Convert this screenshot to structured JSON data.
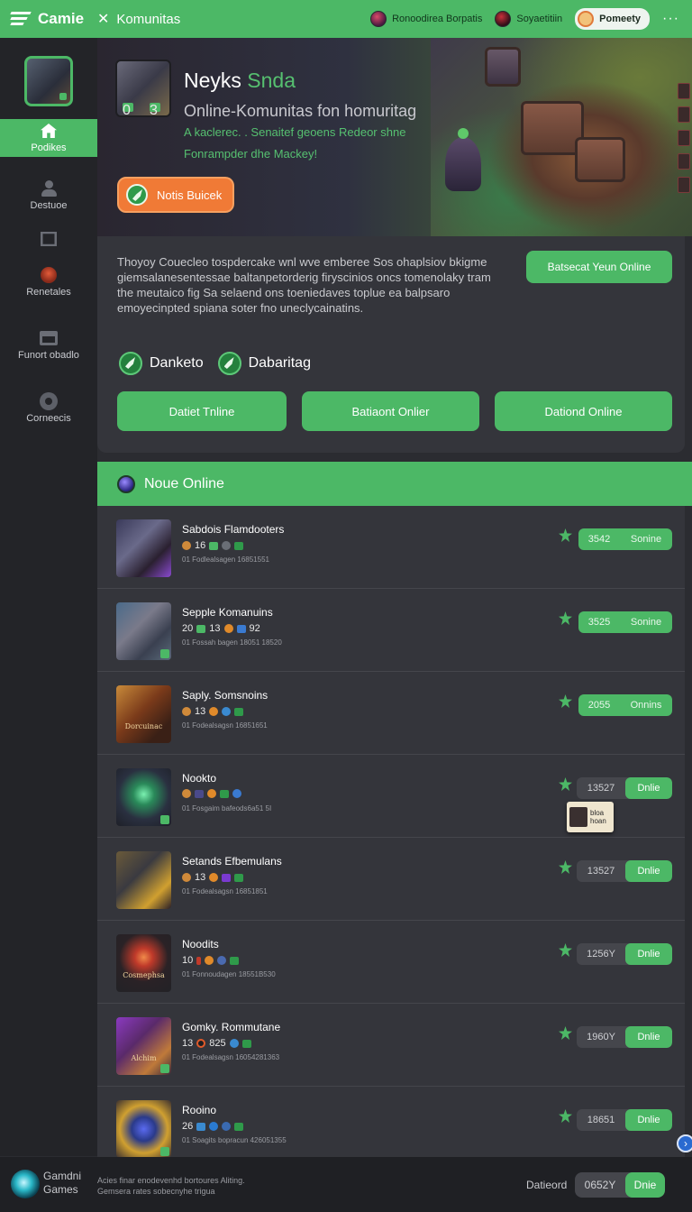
{
  "topbar": {
    "brand": "Camie",
    "close_symbol": "✕",
    "breadcrumb": "Komunitas",
    "user1": "Ronoodirea Borpatis",
    "user2": "Soyaetitiin",
    "profile": "Pomeety",
    "more": "···"
  },
  "sidebar": {
    "items": [
      {
        "label": "Podikes",
        "icon": "home-icon",
        "active": true
      },
      {
        "label": "Destuoe",
        "icon": "user-icon"
      },
      {
        "label": "",
        "icon": "chart-icon"
      },
      {
        "label": "Renetales",
        "icon": "record-icon"
      },
      {
        "label": "Funort obadlo",
        "icon": "box-icon"
      },
      {
        "label": "Corneecis",
        "icon": "gear-icon"
      }
    ]
  },
  "hero": {
    "thumb_values": [
      "0",
      "3"
    ],
    "title": "Neyks",
    "title_accent": "Snda",
    "subtitle": "Online-Komunitas fon homuritag",
    "tagline1": "A  kaclerec. . Senaitef geoens Redeor shne",
    "tagline2": "Fonrampder dhe Mackey!",
    "button": "Notis Buicek"
  },
  "info": {
    "text": "Thoyoy Couecleo tospdercake wnl wve emberee Sos ohaplsiov bkigme giemsalanesentessae baltanpetorderig firyscinios oncs tomenolaky tram the meutaico fig Sa selaend ons toeniedaves toplue ea balpsaro emoyecinpted spiana soter fno uneclycainatins.",
    "cta": "Batsecat Yeun Online",
    "chips": [
      "Danketo",
      "Dabaritag"
    ],
    "buttons": [
      "Datiet Tnline",
      "Batiaont Onlier",
      "Dationd Online"
    ]
  },
  "list": {
    "header": "Noue Online",
    "rows": [
      {
        "name": "Sabdois Flamdooters",
        "meta_num": "16",
        "sub": "01 Fodlealsagen 16851551",
        "stat_value": "3542",
        "stat_label": "Sonine",
        "style": "a"
      },
      {
        "name": "Sepple Komanuins",
        "meta_num": "20",
        "meta_num2": "13",
        "meta_num3": "92",
        "sub": "01 Fossah bagen 18051 18520",
        "stat_value": "3525",
        "stat_label": "Sonine",
        "style": "a"
      },
      {
        "name": "Saply. Somsnoins",
        "meta_num": "13",
        "sub": "01 Fodealsagsn 16851651",
        "stat_value": "2055",
        "stat_label": "Onnins",
        "style": "a",
        "thumb_text": "Dorcuinac"
      },
      {
        "name": "Nookto",
        "sub": "01 Fosgaim bafeods6a51 5I",
        "stat_value": "13527",
        "stat_label": "Dnlie",
        "style": "b"
      },
      {
        "name": "Setands Efbemulans",
        "meta_num": "13",
        "sub": "01 Fodealsagsn 16851851",
        "stat_value": "13527",
        "stat_label": "Dnlie",
        "style": "b"
      },
      {
        "name": "Noodits",
        "meta_num": "10",
        "sub": "01 Fonnoudagen 18551B530",
        "stat_value": "1256Y",
        "stat_label": "Dnlie",
        "style": "b",
        "thumb_text": "Cosmephsa"
      },
      {
        "name": "Gomky. Rommutane",
        "meta_num": "13",
        "meta_num2": "825",
        "sub": "01 Fodealsagsn 16054281363",
        "stat_value": "1960Y",
        "stat_label": "Dnlie",
        "style": "b",
        "thumb_text": "Alchim"
      },
      {
        "name": "Rooino",
        "meta_num": "26",
        "sub": "01 Soagits bopracun 426051355",
        "stat_value": "18651",
        "stat_label": "Dnlie",
        "style": "b"
      }
    ],
    "popup": "bloa\nhoan"
  },
  "footer": {
    "brand_line1": "Gamdni",
    "brand_line2": "Games",
    "text1": "Acies finar enodevenhd bortoures Aliting.",
    "text2": "Gemsera rates sobecnyhe trigua",
    "label": "Datieord",
    "stat_value": "0652Y",
    "stat_label": "Dnie"
  },
  "colors": {
    "accent": "#4cb866",
    "orange": "#f07a36",
    "panel": "#34353b",
    "sidebar": "#232428"
  }
}
